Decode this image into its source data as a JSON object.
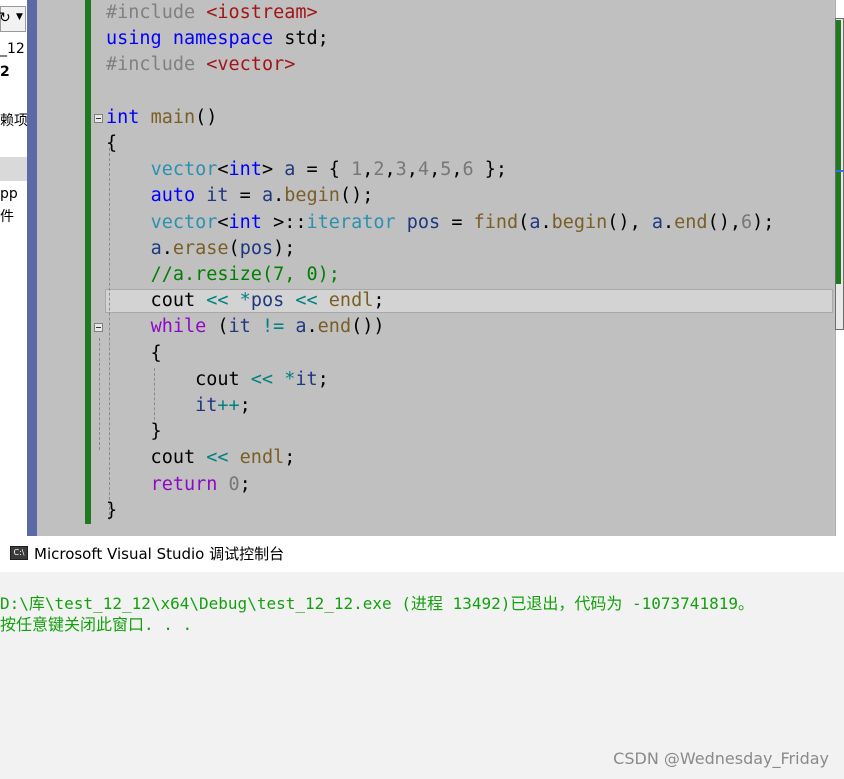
{
  "solution_explorer": {
    "items": [
      "_12",
      "2",
      "赖项",
      "pp",
      "件"
    ]
  },
  "editor": {
    "lines": [
      [
        {
          "t": "#include ",
          "c": "pp"
        },
        {
          "t": "<iostream>",
          "c": "str"
        }
      ],
      [
        {
          "t": "using",
          "c": "kw"
        },
        {
          "t": " "
        },
        {
          "t": "namespace",
          "c": "kw"
        },
        {
          "t": " std;"
        }
      ],
      [
        {
          "t": "#include ",
          "c": "pp"
        },
        {
          "t": "<vector>",
          "c": "str"
        }
      ],
      [],
      [
        {
          "t": "int",
          "c": "kw"
        },
        {
          "t": " "
        },
        {
          "t": "main",
          "c": "fn"
        },
        {
          "t": "()"
        }
      ],
      [
        {
          "t": "{"
        }
      ],
      [
        {
          "t": "    "
        },
        {
          "t": "vector",
          "c": "ty"
        },
        {
          "t": "<"
        },
        {
          "t": "int",
          "c": "kw"
        },
        {
          "t": "> "
        },
        {
          "t": "a",
          "c": "var"
        },
        {
          "t": " = { "
        },
        {
          "t": "1",
          "c": "num"
        },
        {
          "t": ","
        },
        {
          "t": "2",
          "c": "num"
        },
        {
          "t": ","
        },
        {
          "t": "3",
          "c": "num"
        },
        {
          "t": ","
        },
        {
          "t": "4",
          "c": "num"
        },
        {
          "t": ","
        },
        {
          "t": "5",
          "c": "num"
        },
        {
          "t": ","
        },
        {
          "t": "6",
          "c": "num"
        },
        {
          "t": " };"
        }
      ],
      [
        {
          "t": "    "
        },
        {
          "t": "auto",
          "c": "kw"
        },
        {
          "t": " "
        },
        {
          "t": "it",
          "c": "var"
        },
        {
          "t": " = "
        },
        {
          "t": "a",
          "c": "var"
        },
        {
          "t": "."
        },
        {
          "t": "begin",
          "c": "fn"
        },
        {
          "t": "();"
        }
      ],
      [
        {
          "t": "    "
        },
        {
          "t": "vector",
          "c": "ty"
        },
        {
          "t": "<"
        },
        {
          "t": "int",
          "c": "kw"
        },
        {
          "t": " >::"
        },
        {
          "t": "iterator",
          "c": "ty"
        },
        {
          "t": " "
        },
        {
          "t": "pos",
          "c": "var"
        },
        {
          "t": " = "
        },
        {
          "t": "find",
          "c": "fn"
        },
        {
          "t": "("
        },
        {
          "t": "a",
          "c": "var"
        },
        {
          "t": "."
        },
        {
          "t": "begin",
          "c": "fn"
        },
        {
          "t": "(), "
        },
        {
          "t": "a",
          "c": "var"
        },
        {
          "t": "."
        },
        {
          "t": "end",
          "c": "fn"
        },
        {
          "t": "(),"
        },
        {
          "t": "6",
          "c": "num"
        },
        {
          "t": ");"
        }
      ],
      [
        {
          "t": "    "
        },
        {
          "t": "a",
          "c": "var"
        },
        {
          "t": "."
        },
        {
          "t": "erase",
          "c": "fn"
        },
        {
          "t": "("
        },
        {
          "t": "pos",
          "c": "var"
        },
        {
          "t": ");"
        }
      ],
      [
        {
          "t": "    "
        },
        {
          "t": "//a.resize(7, 0);",
          "c": "cm"
        }
      ],
      [
        {
          "t": "    cout "
        },
        {
          "t": "<<",
          "c": "op"
        },
        {
          "t": " "
        },
        {
          "t": "*",
          "c": "op"
        },
        {
          "t": "pos",
          "c": "var"
        },
        {
          "t": " "
        },
        {
          "t": "<<",
          "c": "op"
        },
        {
          "t": " "
        },
        {
          "t": "endl",
          "c": "fn"
        },
        {
          "t": ";"
        }
      ],
      [
        {
          "t": "    "
        },
        {
          "t": "while",
          "c": "ctl"
        },
        {
          "t": " ("
        },
        {
          "t": "it",
          "c": "var"
        },
        {
          "t": " "
        },
        {
          "t": "!=",
          "c": "op"
        },
        {
          "t": " "
        },
        {
          "t": "a",
          "c": "var"
        },
        {
          "t": "."
        },
        {
          "t": "end",
          "c": "fn"
        },
        {
          "t": "())"
        }
      ],
      [
        {
          "t": "    {"
        }
      ],
      [
        {
          "t": "        cout "
        },
        {
          "t": "<<",
          "c": "op"
        },
        {
          "t": " "
        },
        {
          "t": "*",
          "c": "op"
        },
        {
          "t": "it",
          "c": "var"
        },
        {
          "t": ";"
        }
      ],
      [
        {
          "t": "        "
        },
        {
          "t": "it",
          "c": "var"
        },
        {
          "t": "++",
          "c": "op"
        },
        {
          "t": ";"
        }
      ],
      [
        {
          "t": "    }"
        }
      ],
      [
        {
          "t": "    cout "
        },
        {
          "t": "<<",
          "c": "op"
        },
        {
          "t": " "
        },
        {
          "t": "endl",
          "c": "fn"
        },
        {
          "t": ";"
        }
      ],
      [
        {
          "t": "    "
        },
        {
          "t": "return",
          "c": "ctl"
        },
        {
          "t": " "
        },
        {
          "t": "0",
          "c": "num"
        },
        {
          "t": ";"
        }
      ],
      [
        {
          "t": "}"
        }
      ]
    ]
  },
  "console": {
    "icon_label": "C:\\",
    "title": "Microsoft Visual Studio 调试控制台",
    "lines": [
      "D:\\库\\test_12_12\\x64\\Debug\\test_12_12.exe (进程 13492)已退出，代码为 -1073741819。",
      "按任意键关闭此窗口. . ."
    ]
  },
  "watermark": "CSDN @Wednesday_Friday",
  "colors": {
    "keyword": "#0000ff",
    "preprocessor": "#808080",
    "string": "#a31515",
    "type": "#2b91af",
    "function": "#795e26",
    "number": "#777777",
    "comment": "#008000",
    "control": "#8f08c4",
    "variable": "#1f377f",
    "operator": "#008080",
    "console_text": "#13a10e",
    "change_bar": "#1f7a1f",
    "editor_background": "#c0c0c0"
  }
}
